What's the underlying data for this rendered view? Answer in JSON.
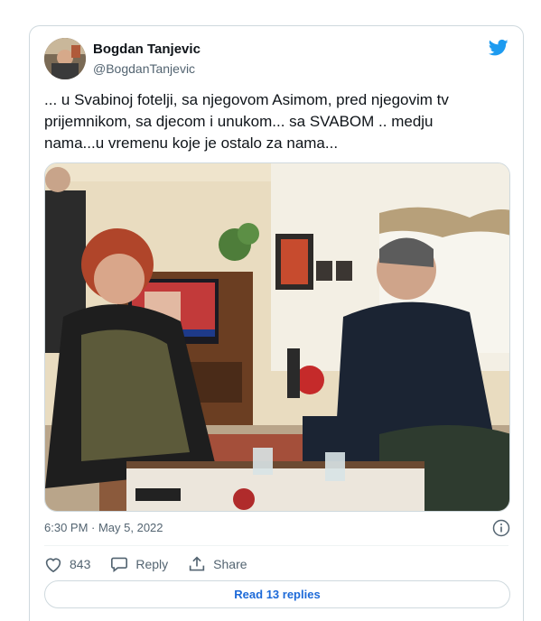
{
  "tweet": {
    "author_name": "Bogdan Tanjevic",
    "author_handle": "@BogdanTanjevic",
    "text": "... u Svabinoj fotelji, sa njegovom Asimom, pred njegovim tv prijemnikom, sa djecom i unukom... sa SVABOM .. medju nama...u vremenu koje je ostalo za nama...",
    "timestamp": "6:30 PM · May 5, 2022",
    "likes": "843",
    "reply_label": "Reply",
    "share_label": "Share",
    "read_replies_label": "Read 13 replies"
  },
  "icons": {
    "brand": "twitter-bird-icon",
    "info": "info-icon",
    "like": "heart-icon",
    "reply": "speech-bubble-icon",
    "share": "share-upload-icon"
  },
  "colors": {
    "twitter_blue": "#1d9bf0",
    "link_blue": "#1d6ad8",
    "secondary_text": "#536471",
    "border": "#cfd9de"
  }
}
